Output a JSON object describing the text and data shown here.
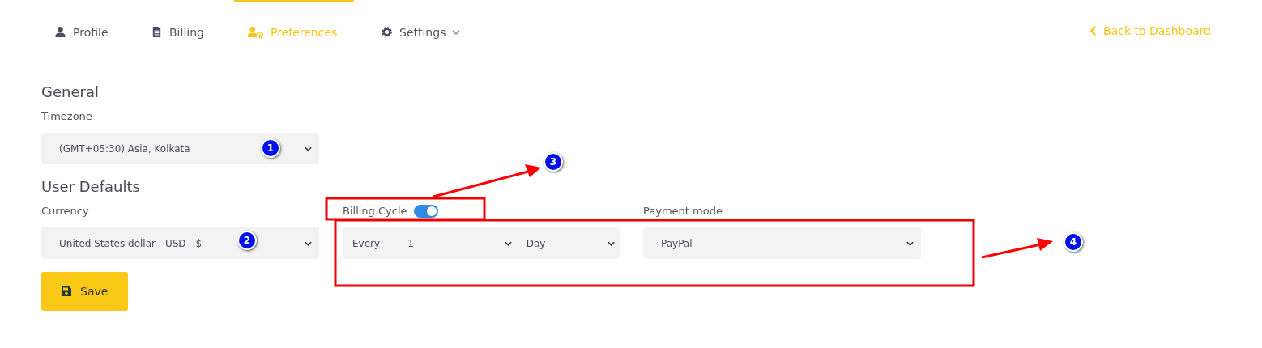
{
  "tabs": [
    {
      "label": "Profile",
      "kind": "user",
      "selected": false,
      "dropdown": false
    },
    {
      "label": "Billing",
      "kind": "document",
      "selected": false,
      "dropdown": false
    },
    {
      "label": "Preferences",
      "kind": "usergear",
      "selected": true,
      "dropdown": false
    },
    {
      "label": "Settings",
      "kind": "gear",
      "selected": false,
      "dropdown": true
    }
  ],
  "back_link": "Back to Dashboard",
  "general": {
    "heading": "General",
    "timezone": {
      "label": "Timezone",
      "value": "(GMT+05:30) Asia, Kolkata"
    }
  },
  "user_defaults": {
    "heading": "User Defaults",
    "currency": {
      "label": "Currency",
      "value": "United States dollar - USD - $"
    },
    "billing_cycle": {
      "label": "Billing Cycle",
      "on": true,
      "prefix": "Every",
      "count": "1",
      "unit": "Day"
    },
    "payment_mode": {
      "label": "Payment mode",
      "value": "PayPal"
    }
  },
  "save_button": "Save",
  "annotations": [
    {
      "label": "1"
    },
    {
      "label": "2"
    },
    {
      "label": "3"
    },
    {
      "label": "4"
    }
  ]
}
